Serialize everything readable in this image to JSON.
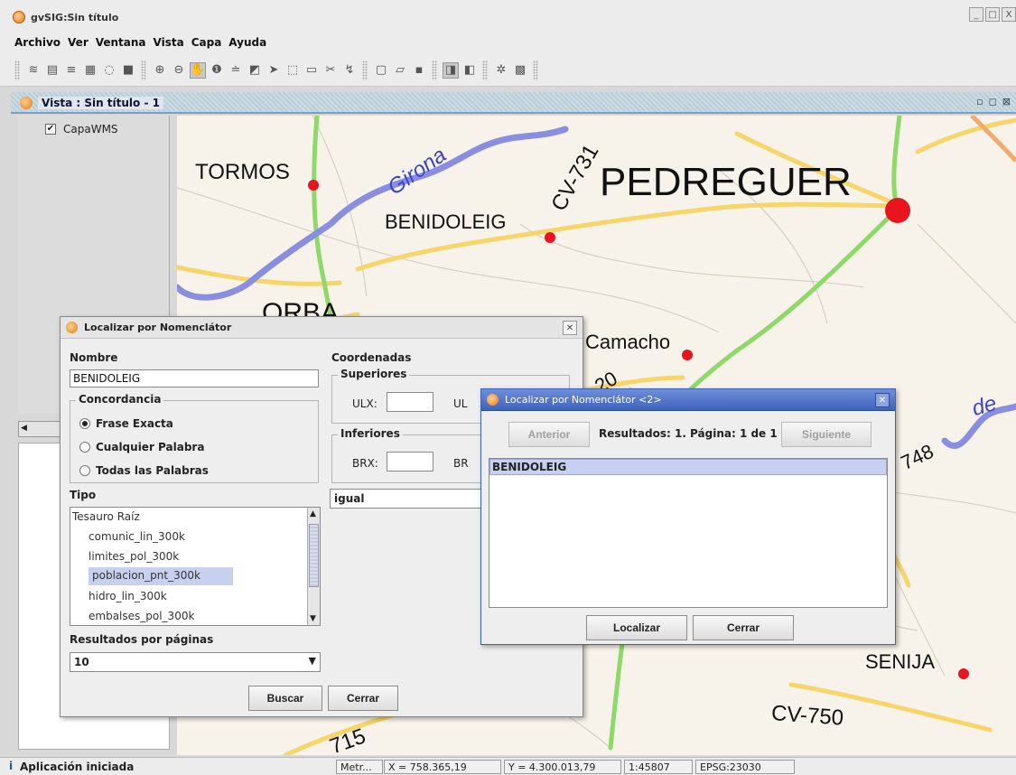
{
  "window": {
    "title": "gvSIG:Sin título",
    "controls": [
      "_",
      "□",
      "X"
    ]
  },
  "menubar": [
    "Archivo",
    "Ver",
    "Ventana",
    "Vista",
    "Capa",
    "Ayuda"
  ],
  "view": {
    "title": "Vista : Sin título - 1",
    "toc_layer": "CapaWMS",
    "toc_layer_checked": true,
    "map_labels": {
      "tormos": "TORMOS",
      "girona": "Girona",
      "cv731": "CV-731",
      "pedreguer": "PEDREGUER",
      "benidoleig": "BENIDOLEIG",
      "orba": "ORBA",
      "camacho": "Camacho",
      "cv720_fragment": "20",
      "cv748_fragment": "748",
      "de_fragment": "de",
      "senija": "SENIJA",
      "cv750": "CV-750",
      "cv715_fragment": "715"
    }
  },
  "search_dialog": {
    "title": "Localizar por Nomenclátor",
    "nombre_label": "Nombre",
    "nombre_value": "BENIDOLEIG",
    "concordancia_label": "Concordancia",
    "radio_options": [
      "Frase Exacta",
      "Cualquier Palabra",
      "Todas las Palabras"
    ],
    "radio_selected": "Frase Exacta",
    "tipo_label": "Tipo",
    "tipo_tree": [
      "Tesauro Raíz",
      "comunic_lin_300k",
      "limites_pol_300k",
      "poblacion_pnt_300k",
      "hidro_lin_300k",
      "embalses_pol_300k"
    ],
    "tipo_selected": "poblacion_pnt_300k",
    "resultados_label": "Resultados por páginas",
    "resultados_value": "10",
    "coordenadas_label": "Coordenadas",
    "superiores_label": "Superiores",
    "ulx_label": "ULX:",
    "uly_label": "UL",
    "inferiores_label": "Inferiores",
    "brx_label": "BRX:",
    "bry_label": "BR",
    "relation_value": "igual",
    "buscar_button": "Buscar",
    "cerrar_button": "Cerrar"
  },
  "results_dialog": {
    "title": "Localizar por Nomenclátor <2>",
    "anterior_button": "Anterior",
    "summary": "Resultados: 1. Página: 1 de 1",
    "siguiente_button": "Siguiente",
    "items": [
      "BENIDOLEIG"
    ],
    "localizar_button": "Localizar",
    "cerrar_button": "Cerrar"
  },
  "statusbar": {
    "message": "Aplicación iniciada",
    "units": "Metr...",
    "x": "X = 758.365,19",
    "y": "Y = 4.300.013,79",
    "scale": "1:45807",
    "crs": "EPSG:23030"
  },
  "colors": {
    "river": "#8a8ee0",
    "yellow_road": "#f6d66a",
    "green_road": "#8fd86a",
    "town_dot": "#e8141e",
    "selection": "#c8d0f0",
    "results_titlebar": "#4a6cc4"
  }
}
